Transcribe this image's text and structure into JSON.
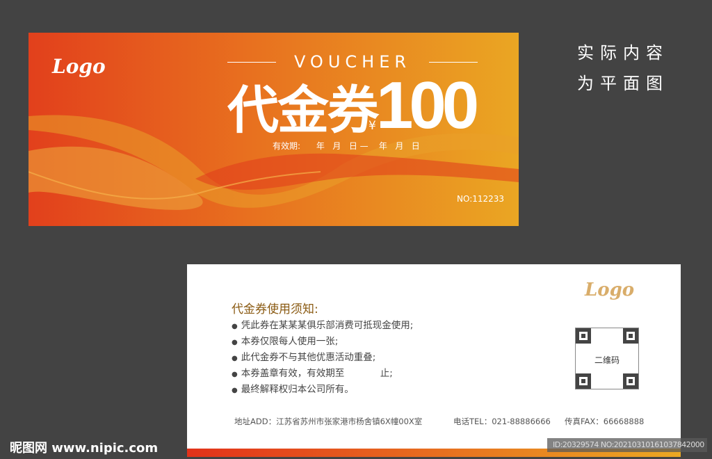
{
  "front": {
    "logo": "Logo",
    "voucher_label": "VOUCHER",
    "title": "代金券",
    "currency": "¥",
    "amount": "100",
    "validity": "有效期:      年   月   日 —    年   月   日",
    "number": "NO:112233"
  },
  "side_note": [
    "实际内容",
    "为平面图"
  ],
  "back": {
    "logo": "Logo",
    "notice_title": "代金券使用须知:",
    "rules": [
      "凭此券在某某某俱乐部消费可抵现金使用;",
      "本券仅限每人使用一张;",
      "此代金券不与其他优惠活动重叠;",
      "本券盖章有效，有效期至            止;",
      "最终解释权归本公司所有。"
    ],
    "qr_label": "二维码",
    "address": "地址ADD：江苏省苏州市张家港市杨舍镇6X幢00X室",
    "phone": "电话TEL：021-88886666",
    "fax": "传真FAX：66668888"
  },
  "watermark": {
    "site": "昵图网 www.nipic.com",
    "id": "ID:20329574 NO:20210310161037842000"
  }
}
